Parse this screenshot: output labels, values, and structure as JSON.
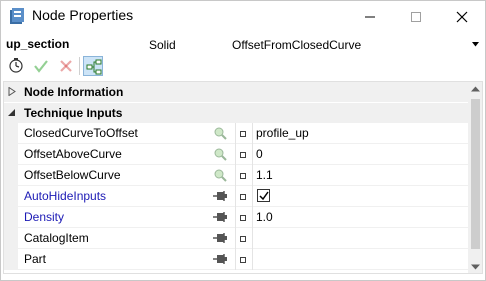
{
  "window": {
    "title": "Node Properties",
    "icons": {
      "app": "node-properties-app-icon",
      "minimize": "minimize-icon",
      "maximize": "maximize-icon",
      "close": "close-icon"
    }
  },
  "header": {
    "node_name": "up_section",
    "node_type": "Solid",
    "technique": "OffsetFromClosedCurve"
  },
  "toolbar": {
    "icons": [
      "clock-icon",
      "check-icon",
      "x-icon",
      "tree-view-icon"
    ]
  },
  "sections": [
    {
      "label": "Node Information",
      "expanded": false
    },
    {
      "label": "Technique Inputs",
      "expanded": true
    }
  ],
  "properties": [
    {
      "name": "ClosedCurveToOffset",
      "linked": false,
      "icon": "magnifier-icon",
      "value": "profile_up"
    },
    {
      "name": "OffsetAboveCurve",
      "linked": false,
      "icon": "magnifier-icon",
      "value": "0"
    },
    {
      "name": "OffsetBelowCurve",
      "linked": false,
      "icon": "magnifier-icon",
      "value": "1.1"
    },
    {
      "name": "AutoHideInputs",
      "linked": true,
      "icon": "pin-icon",
      "value": "",
      "checkbox": true,
      "checked": true
    },
    {
      "name": "Density",
      "linked": true,
      "icon": "pin-icon",
      "value": "1.0"
    },
    {
      "name": "CatalogItem",
      "linked": false,
      "icon": "pin-icon",
      "value": ""
    },
    {
      "name": "Part",
      "linked": false,
      "icon": "pin-icon",
      "value": ""
    }
  ],
  "colors": {
    "linked_text": "#1c1ab5",
    "check_green": "#3caa3c",
    "x_red": "#d23c3c"
  }
}
